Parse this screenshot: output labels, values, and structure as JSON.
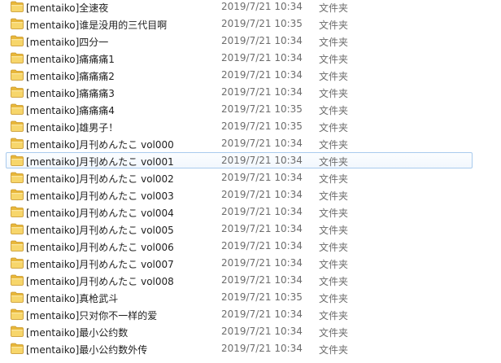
{
  "rows": [
    {
      "name": "[mentaiko]全速夜",
      "date": "2019/7/21 10:34",
      "type": "文件夹"
    },
    {
      "name": "[mentaiko]谁是没用的三代目啊",
      "date": "2019/7/21 10:35",
      "type": "文件夹"
    },
    {
      "name": "[mentaiko]四分一",
      "date": "2019/7/21 10:34",
      "type": "文件夹"
    },
    {
      "name": "[mentaiko]痛痛痛1",
      "date": "2019/7/21 10:34",
      "type": "文件夹"
    },
    {
      "name": "[mentaiko]痛痛痛2",
      "date": "2019/7/21 10:34",
      "type": "文件夹"
    },
    {
      "name": "[mentaiko]痛痛痛3",
      "date": "2019/7/21 10:34",
      "type": "文件夹"
    },
    {
      "name": "[mentaiko]痛痛痛4",
      "date": "2019/7/21 10:35",
      "type": "文件夹"
    },
    {
      "name": "[mentaiko]雄男子！",
      "date": "2019/7/21 10:35",
      "type": "文件夹"
    },
    {
      "name": "[mentaiko]月刊めんたこ vol000",
      "date": "2019/7/21 10:34",
      "type": "文件夹"
    },
    {
      "name": "[mentaiko]月刊めんたこ vol001",
      "date": "2019/7/21 10:34",
      "type": "文件夹"
    },
    {
      "name": "[mentaiko]月刊めんたこ vol002",
      "date": "2019/7/21 10:34",
      "type": "文件夹"
    },
    {
      "name": "[mentaiko]月刊めんたこ vol003",
      "date": "2019/7/21 10:34",
      "type": "文件夹"
    },
    {
      "name": "[mentaiko]月刊めんたこ vol004",
      "date": "2019/7/21 10:34",
      "type": "文件夹"
    },
    {
      "name": "[mentaiko]月刊めんたこ vol005",
      "date": "2019/7/21 10:34",
      "type": "文件夹"
    },
    {
      "name": "[mentaiko]月刊めんたこ vol006",
      "date": "2019/7/21 10:34",
      "type": "文件夹"
    },
    {
      "name": "[mentaiko]月刊めんたこ vol007",
      "date": "2019/7/21 10:34",
      "type": "文件夹"
    },
    {
      "name": "[mentaiko]月刊めんたこ vol008",
      "date": "2019/7/21 10:34",
      "type": "文件夹"
    },
    {
      "name": "[mentaiko]真枪武斗",
      "date": "2019/7/21 10:35",
      "type": "文件夹"
    },
    {
      "name": "[mentaiko]只对你不一样的爱",
      "date": "2019/7/21 10:34",
      "type": "文件夹"
    },
    {
      "name": "[mentaiko]最小公约数",
      "date": "2019/7/21 10:34",
      "type": "文件夹"
    },
    {
      "name": "[mentaiko]最小公约数外传",
      "date": "2019/7/21 10:34",
      "type": "文件夹"
    }
  ],
  "hovered_row": 9,
  "icon": "folder-icon",
  "colors": {
    "hover_border": "#a9cbee",
    "folder_yellow": "#f0c24a"
  }
}
